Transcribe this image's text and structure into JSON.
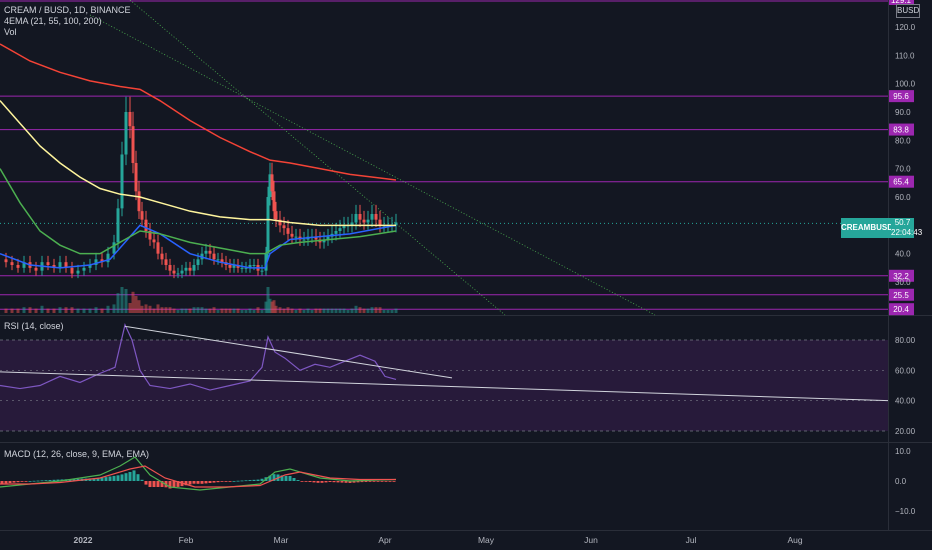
{
  "header": {
    "symbol_line": "CREAM / BUSD, 1D, BINANCE",
    "ema_line": "4EMA (21, 55, 100, 200)",
    "vol_line": "Vol",
    "currency_badge": "BUSD"
  },
  "price_axis": {
    "ticks": [
      "120.0",
      "110.0",
      "100.0",
      "90.0",
      "80.0",
      "70.0",
      "60.0",
      "50.0",
      "40.0",
      "30.0"
    ],
    "top_label": "129.1",
    "levels": [
      {
        "label": "95.6",
        "value": 95.6
      },
      {
        "label": "83.8",
        "value": 83.8
      },
      {
        "label": "65.4",
        "value": 65.4
      },
      {
        "label": "32.2",
        "value": 32.2
      },
      {
        "label": "25.5",
        "value": 25.5
      },
      {
        "label": "20.4",
        "value": 20.4
      }
    ],
    "last_symbol": "CREAMBUSD",
    "last_price": "50.7",
    "countdown": "22:04:43"
  },
  "rsi": {
    "title": "RSI (14, close)",
    "ticks": [
      "80.00",
      "60.00",
      "40.00",
      "20.00"
    ]
  },
  "macd": {
    "title": "MACD (12, 26, close, 9, EMA, EMA)",
    "ticks": [
      "10.0",
      "0.0",
      "−10.0"
    ]
  },
  "time_axis": {
    "labels": [
      "2022",
      "Feb",
      "Mar",
      "Apr",
      "May",
      "Jun",
      "Jul",
      "Aug"
    ]
  },
  "colors": {
    "background": "#131722",
    "level_line": "#9c27b0",
    "up": "#26a69a",
    "down": "#ef5350",
    "ema21": "#2962ff",
    "ema55": "#4caf50",
    "ema100": "#fff59d",
    "ema200": "#f44336",
    "rsi": "#7e57c2",
    "macd_line": "#4caf50",
    "signal_line": "#ef5350"
  },
  "chart_data": {
    "type": "line",
    "title": "CREAM / BUSD, 1D, BINANCE",
    "ylim": [
      18,
      129
    ],
    "close_series": [
      {
        "name": "CREAM/BUSD close (approx)",
        "points": [
          [
            0,
            38
          ],
          [
            6,
            37
          ],
          [
            12,
            36
          ],
          [
            18,
            35
          ],
          [
            24,
            37
          ],
          [
            30,
            35
          ],
          [
            36,
            34
          ],
          [
            42,
            37
          ],
          [
            48,
            36
          ],
          [
            54,
            35
          ],
          [
            60,
            37
          ],
          [
            66,
            35
          ],
          [
            72,
            33
          ],
          [
            78,
            34
          ],
          [
            84,
            35
          ],
          [
            90,
            36
          ],
          [
            96,
            38
          ],
          [
            102,
            37
          ],
          [
            108,
            40
          ],
          [
            114,
            44
          ],
          [
            118,
            56
          ],
          [
            122,
            75
          ],
          [
            126,
            90
          ],
          [
            130,
            85
          ],
          [
            133,
            72
          ],
          [
            136,
            62
          ],
          [
            139,
            55
          ],
          [
            142,
            52
          ],
          [
            146,
            48
          ],
          [
            150,
            45
          ],
          [
            154,
            44
          ],
          [
            158,
            40
          ],
          [
            162,
            38
          ],
          [
            166,
            36
          ],
          [
            170,
            34
          ],
          [
            174,
            33
          ],
          [
            178,
            33
          ],
          [
            182,
            34
          ],
          [
            186,
            35
          ],
          [
            190,
            34
          ],
          [
            194,
            36
          ],
          [
            198,
            38
          ],
          [
            202,
            40
          ],
          [
            206,
            41
          ],
          [
            210,
            40
          ],
          [
            214,
            38
          ],
          [
            218,
            38
          ],
          [
            222,
            37
          ],
          [
            226,
            36
          ],
          [
            230,
            35
          ],
          [
            234,
            36
          ],
          [
            238,
            35
          ],
          [
            242,
            35
          ],
          [
            246,
            35
          ],
          [
            250,
            36
          ],
          [
            254,
            36
          ],
          [
            258,
            34
          ],
          [
            262,
            34
          ],
          [
            266,
            40
          ],
          [
            268,
            60
          ],
          [
            270,
            68
          ],
          [
            272,
            62
          ],
          [
            274,
            55
          ],
          [
            276,
            52
          ],
          [
            280,
            50
          ],
          [
            284,
            49
          ],
          [
            288,
            47
          ],
          [
            292,
            46
          ],
          [
            296,
            46
          ],
          [
            300,
            45
          ],
          [
            304,
            45
          ],
          [
            308,
            46
          ],
          [
            312,
            46
          ],
          [
            316,
            45
          ],
          [
            320,
            44
          ],
          [
            324,
            45
          ],
          [
            328,
            46
          ],
          [
            332,
            47
          ],
          [
            336,
            48
          ],
          [
            340,
            49
          ],
          [
            344,
            50
          ],
          [
            348,
            50
          ],
          [
            352,
            51
          ],
          [
            356,
            54
          ],
          [
            360,
            52
          ],
          [
            364,
            51
          ],
          [
            368,
            52
          ],
          [
            372,
            54
          ],
          [
            376,
            52
          ],
          [
            380,
            50
          ],
          [
            384,
            50
          ],
          [
            388,
            50
          ],
          [
            392,
            50
          ],
          [
            396,
            51
          ]
        ]
      }
    ],
    "ema_series": [
      {
        "name": "EMA 21",
        "color": "#2962ff",
        "points": [
          [
            0,
            40
          ],
          [
            30,
            36
          ],
          [
            60,
            35
          ],
          [
            90,
            36
          ],
          [
            110,
            38
          ],
          [
            125,
            44
          ],
          [
            140,
            50
          ],
          [
            160,
            47
          ],
          [
            190,
            40
          ],
          [
            220,
            37
          ],
          [
            250,
            35
          ],
          [
            265,
            35
          ],
          [
            270,
            40
          ],
          [
            290,
            45
          ],
          [
            320,
            46
          ],
          [
            350,
            47
          ],
          [
            396,
            50
          ]
        ]
      },
      {
        "name": "EMA 55",
        "color": "#4caf50",
        "points": [
          [
            0,
            70
          ],
          [
            20,
            58
          ],
          [
            40,
            48
          ],
          [
            60,
            43
          ],
          [
            80,
            40
          ],
          [
            100,
            40
          ],
          [
            120,
            44
          ],
          [
            140,
            48
          ],
          [
            160,
            47
          ],
          [
            190,
            44
          ],
          [
            220,
            42
          ],
          [
            250,
            40
          ],
          [
            265,
            40
          ],
          [
            280,
            43
          ],
          [
            300,
            44
          ],
          [
            330,
            45
          ],
          [
            360,
            46
          ],
          [
            396,
            48
          ]
        ]
      },
      {
        "name": "EMA 100",
        "color": "#fff59d",
        "points": [
          [
            0,
            94
          ],
          [
            20,
            86
          ],
          [
            40,
            78
          ],
          [
            60,
            72
          ],
          [
            80,
            67
          ],
          [
            100,
            63
          ],
          [
            120,
            61
          ],
          [
            140,
            60
          ],
          [
            160,
            58
          ],
          [
            190,
            55
          ],
          [
            220,
            53
          ],
          [
            250,
            52
          ],
          [
            270,
            52
          ],
          [
            290,
            51
          ],
          [
            320,
            50
          ],
          [
            350,
            50
          ],
          [
            396,
            50
          ]
        ]
      },
      {
        "name": "EMA 200",
        "color": "#f44336",
        "points": [
          [
            0,
            114
          ],
          [
            30,
            108
          ],
          [
            60,
            104
          ],
          [
            90,
            101
          ],
          [
            120,
            99
          ],
          [
            140,
            98
          ],
          [
            160,
            94
          ],
          [
            190,
            87
          ],
          [
            220,
            81
          ],
          [
            250,
            76
          ],
          [
            270,
            73
          ],
          [
            290,
            72
          ],
          [
            320,
            70
          ],
          [
            350,
            68
          ],
          [
            396,
            66
          ]
        ]
      }
    ],
    "rsi_series": {
      "name": "RSI 14",
      "points": [
        [
          0,
          50
        ],
        [
          20,
          48
        ],
        [
          40,
          50
        ],
        [
          60,
          56
        ],
        [
          80,
          52
        ],
        [
          100,
          58
        ],
        [
          115,
          62
        ],
        [
          125,
          90
        ],
        [
          132,
          80
        ],
        [
          140,
          60
        ],
        [
          150,
          50
        ],
        [
          170,
          48
        ],
        [
          190,
          51
        ],
        [
          210,
          47
        ],
        [
          230,
          50
        ],
        [
          250,
          53
        ],
        [
          262,
          62
        ],
        [
          268,
          82
        ],
        [
          275,
          72
        ],
        [
          285,
          68
        ],
        [
          300,
          60
        ],
        [
          315,
          64
        ],
        [
          330,
          62
        ],
        [
          345,
          66
        ],
        [
          360,
          70
        ],
        [
          375,
          66
        ],
        [
          385,
          56
        ],
        [
          396,
          54
        ]
      ]
    },
    "rsi_trendlines": [
      {
        "from": [
          125,
          89
        ],
        "to": [
          452,
          55
        ]
      },
      {
        "from": [
          0,
          59
        ],
        "to": [
          888,
          40
        ]
      }
    ],
    "macd_series": {
      "name": "MACD",
      "points": [
        [
          0,
          -2
        ],
        [
          30,
          -1
        ],
        [
          60,
          0
        ],
        [
          100,
          2
        ],
        [
          120,
          5
        ],
        [
          135,
          8
        ],
        [
          150,
          2
        ],
        [
          170,
          -2
        ],
        [
          200,
          -3
        ],
        [
          230,
          -2
        ],
        [
          260,
          -1
        ],
        [
          275,
          3
        ],
        [
          290,
          4
        ],
        [
          320,
          1
        ],
        [
          350,
          0
        ],
        [
          396,
          0.5
        ]
      ]
    },
    "signal_series": {
      "name": "Signal",
      "points": [
        [
          0,
          -1
        ],
        [
          30,
          -1
        ],
        [
          60,
          -0.5
        ],
        [
          100,
          1
        ],
        [
          130,
          4
        ],
        [
          145,
          5
        ],
        [
          165,
          1
        ],
        [
          195,
          -2
        ],
        [
          225,
          -2
        ],
        [
          260,
          -1.5
        ],
        [
          285,
          2
        ],
        [
          300,
          3
        ],
        [
          330,
          1
        ],
        [
          360,
          0.5
        ],
        [
          396,
          0.5
        ]
      ]
    }
  }
}
